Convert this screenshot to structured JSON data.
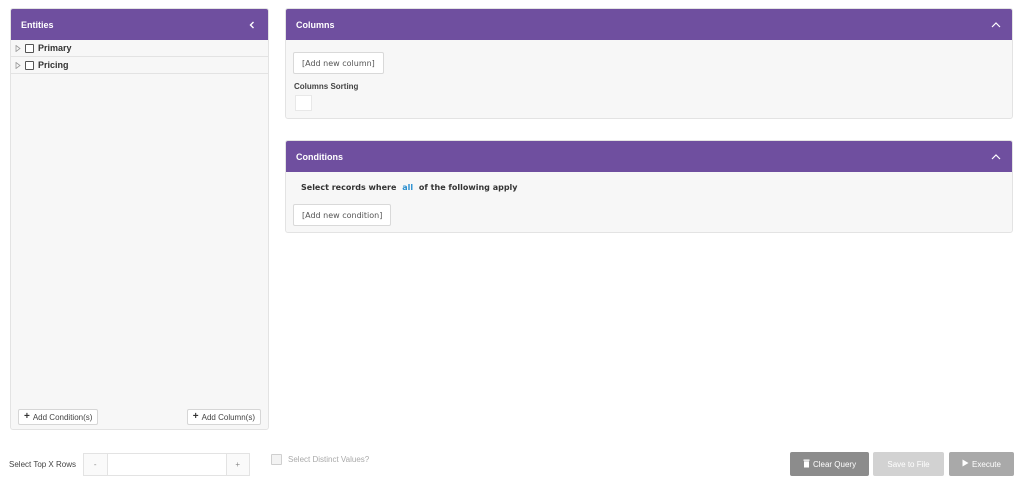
{
  "entities": {
    "title": "Entities",
    "items": [
      {
        "label": "Primary"
      },
      {
        "label": "Pricing"
      }
    ],
    "add_condition_label": "Add Condition(s)",
    "add_column_label": "Add Column(s)"
  },
  "columns": {
    "title": "Columns",
    "add_label": "[Add new column]",
    "sorting_label": "Columns Sorting"
  },
  "conditions": {
    "title": "Conditions",
    "prefix": "Select records where",
    "mode": "all",
    "suffix": "of the following apply",
    "add_label": "[Add new condition]"
  },
  "bottom": {
    "top_rows_label": "Select Top X Rows",
    "minus_label": "-",
    "plus_label": "+",
    "top_rows_value": "",
    "distinct_label": "Select Distinct Values?",
    "distinct_checked": false,
    "clear_label": "Clear Query",
    "save_label": "Save to File",
    "execute_label": "Execute"
  },
  "colors": {
    "header": "#6f4f9f",
    "link": "#2a8fd0"
  }
}
